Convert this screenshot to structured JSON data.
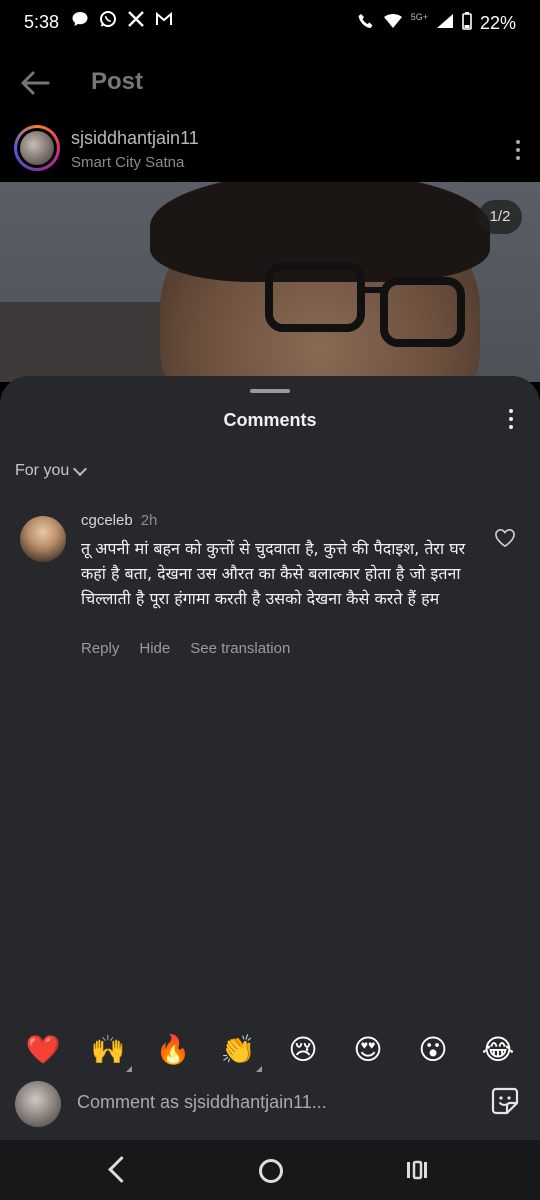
{
  "status_bar": {
    "time": "5:38",
    "network": "5G+",
    "battery": "22%",
    "notification_icons": [
      "chat-bubble-icon",
      "whatsapp-icon",
      "x-icon",
      "gmail-icon"
    ]
  },
  "topbar": {
    "title": "Post"
  },
  "post": {
    "username": "sjsiddhantjain11",
    "location": "Smart City Satna",
    "page_indicator": "1/2"
  },
  "comments_sheet": {
    "title": "Comments",
    "filter_label": "For you",
    "comments": [
      {
        "username": "cgceleb",
        "time": "2h",
        "text": "तू अपनी मां बहन को कुत्तों से चुदवाता है, कुत्ते की पैदाइश, तेरा घर कहां है बता, देखना उस औरत का कैसे बलात्कार होता है जो इतना चिल्लाती है पूरा हंगामा करती है उसको देखना कैसे करते हैं हम",
        "actions": {
          "reply": "Reply",
          "hide": "Hide",
          "translate": "See translation"
        }
      }
    ]
  },
  "reactions": [
    "❤️",
    "🙌",
    "🔥",
    "👏",
    "😢",
    "😍",
    "😮",
    "😂"
  ],
  "composer": {
    "placeholder": "Comment as sjsiddhantjain11..."
  },
  "colors": {
    "background": "#000000",
    "sheet": "#26282c",
    "text_primary": "#f1f1f1",
    "text_secondary": "#9a9a9a"
  }
}
